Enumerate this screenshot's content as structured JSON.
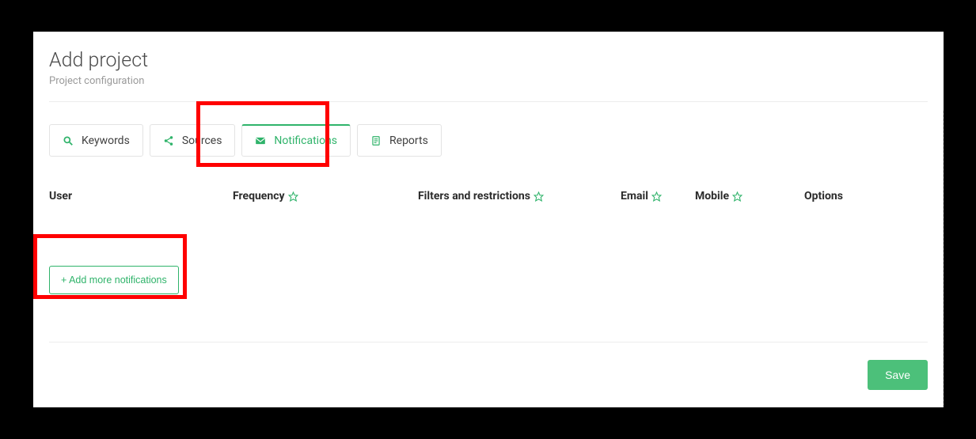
{
  "header": {
    "title": "Add project",
    "subtitle": "Project configuration"
  },
  "tabs": {
    "keywords": "Keywords",
    "sources": "Sources",
    "notifications": "Notifications",
    "reports": "Reports"
  },
  "columns": {
    "user": "User",
    "frequency": "Frequency",
    "filters": "Filters and restrictions",
    "email": "Email",
    "mobile": "Mobile",
    "options": "Options"
  },
  "buttons": {
    "add_more": "+ Add more notifications",
    "save": "Save"
  },
  "colors": {
    "accent": "#2fb36a"
  }
}
